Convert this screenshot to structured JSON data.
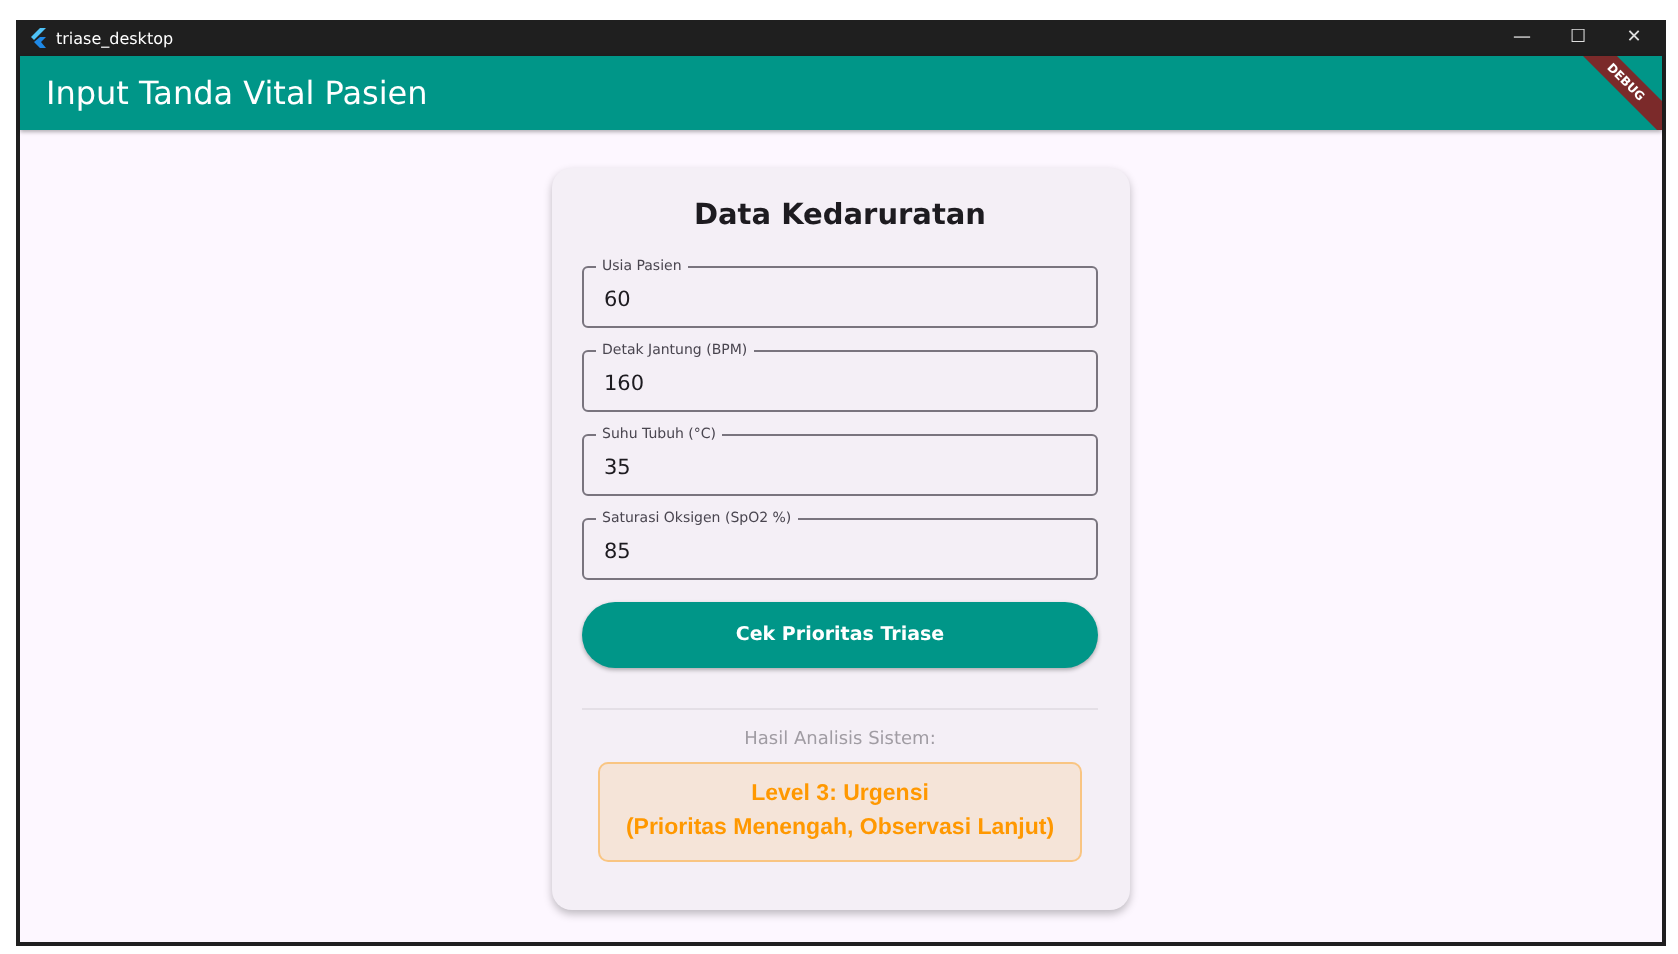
{
  "window": {
    "title": "triase_desktop",
    "controls": [
      "—",
      "☐",
      "✕"
    ]
  },
  "app_bar": {
    "title": "Input Tanda Vital Pasien",
    "banner": "DEBUG"
  },
  "card": {
    "title": "Data Kedaruratan",
    "fields": [
      {
        "label": "Usia Pasien",
        "value": "60"
      },
      {
        "label": "Detak Jantung (BPM)",
        "value": "160"
      },
      {
        "label": "Suhu Tubuh (°C)",
        "value": "35"
      },
      {
        "label": "Saturasi Oksigen (SpO2 %)",
        "value": "85"
      }
    ],
    "button": "Cek Prioritas Triase",
    "result_caption": "Hasil Analisis Sistem:",
    "result": {
      "lines": [
        "Level 3: Urgensi",
        "(Prioritas Menengah, Observasi Lanjut)"
      ],
      "color": "#ff9800"
    }
  }
}
